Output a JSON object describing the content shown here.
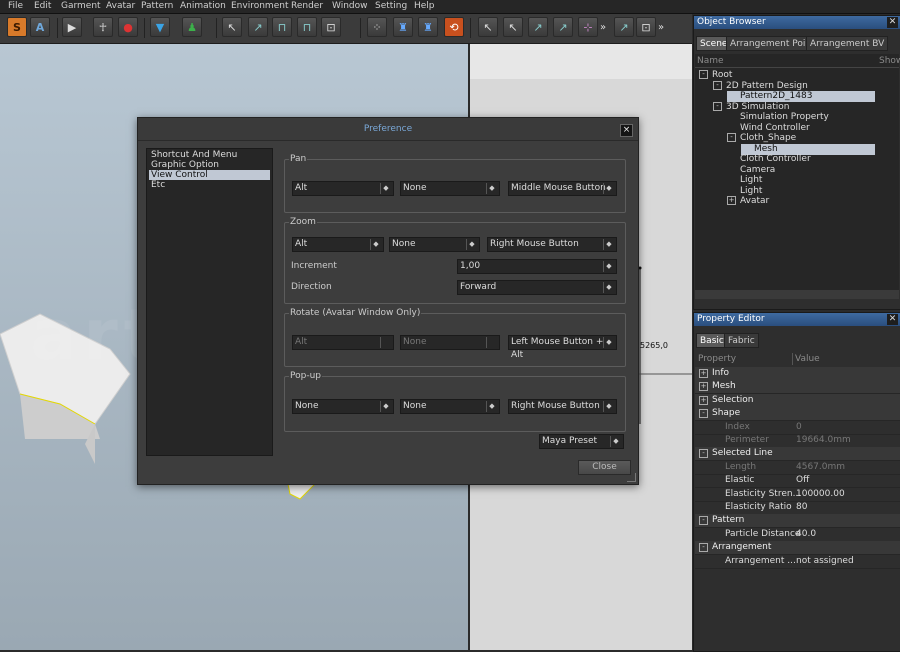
{
  "menu": [
    "File",
    "Edit",
    "Garment",
    "Avatar",
    "Pattern",
    "Animation",
    "Environment",
    "Render",
    "Window",
    "Setting",
    "Help"
  ],
  "toolbar": {
    "mode_s": "S",
    "mode_a": "A",
    "more1": "»",
    "more2": "»"
  },
  "viewport2d": {
    "measure": "5265,0"
  },
  "object_browser": {
    "title": "Object Browser",
    "tabs": [
      "Scene",
      "Arrangement Point",
      "Arrangement BV"
    ],
    "col_name": "Name",
    "col_show": "Show",
    "tree": [
      {
        "label": "Root",
        "level": 0,
        "exp": "-"
      },
      {
        "label": "2D Pattern Design",
        "level": 1,
        "exp": "-"
      },
      {
        "label": "Pattern2D_1483",
        "level": 2,
        "exp": "",
        "selected": true
      },
      {
        "label": "3D Simulation",
        "level": 1,
        "exp": "-"
      },
      {
        "label": "Simulation Property",
        "level": 2,
        "exp": ""
      },
      {
        "label": "Wind Controller",
        "level": 2,
        "exp": ""
      },
      {
        "label": "Cloth_Shape",
        "level": 2,
        "exp": "-"
      },
      {
        "label": "Mesh",
        "level": 3,
        "exp": "",
        "selected": true
      },
      {
        "label": "Cloth Controller",
        "level": 2,
        "exp": ""
      },
      {
        "label": "Camera",
        "level": 2,
        "exp": ""
      },
      {
        "label": "Light",
        "level": 2,
        "exp": ""
      },
      {
        "label": "Light",
        "level": 2,
        "exp": ""
      },
      {
        "label": "Avatar",
        "level": 2,
        "exp": "+"
      }
    ]
  },
  "property_editor": {
    "title": "Property Editor",
    "tabs": [
      "Basic",
      "Fabric"
    ],
    "col_property": "Property",
    "col_value": "Value",
    "rows": [
      {
        "type": "section",
        "exp": "+",
        "name": "Info"
      },
      {
        "type": "section",
        "exp": "+",
        "name": "Mesh"
      },
      {
        "type": "section",
        "exp": "+",
        "name": "Selection"
      },
      {
        "type": "section",
        "exp": "-",
        "name": "Shape"
      },
      {
        "type": "row",
        "name": "Index",
        "value": "0",
        "dim": true
      },
      {
        "type": "row",
        "name": "Perimeter",
        "value": "19664.0mm",
        "dim": true
      },
      {
        "type": "section",
        "exp": "-",
        "name": "Selected Line"
      },
      {
        "type": "row",
        "name": "Length",
        "value": "4567.0mm",
        "dim": true
      },
      {
        "type": "row",
        "name": "Elastic",
        "value": "Off",
        "dim": false
      },
      {
        "type": "row",
        "name": "Elasticity Stren...",
        "value": "100000.00",
        "dim": false
      },
      {
        "type": "row",
        "name": "Elasticity Ratio",
        "value": "80",
        "dim": false
      },
      {
        "type": "section",
        "exp": "-",
        "name": "Pattern"
      },
      {
        "type": "row",
        "name": "Particle Distance",
        "value": "40.0",
        "dim": false
      },
      {
        "type": "section",
        "exp": "-",
        "name": "Arrangement"
      },
      {
        "type": "row",
        "name": "Arrangement ...",
        "value": "not assigned",
        "dim": false
      }
    ]
  },
  "preference": {
    "title": "Preference",
    "close_x": "×",
    "categories": [
      "Shortcut And Menu",
      "Graphic Option",
      "View Control",
      "Etc"
    ],
    "selected_category": "View Control",
    "pan": {
      "label": "Pan",
      "key": "Alt",
      "modifier": "None",
      "button": "Middle Mouse Button"
    },
    "zoom": {
      "label": "Zoom",
      "key": "Alt",
      "modifier": "None",
      "button": "Right Mouse Button",
      "increment_label": "Increment",
      "increment_value": "1,00",
      "direction_label": "Direction",
      "direction_value": "Forward"
    },
    "rotate": {
      "label": "Rotate (Avatar Window Only)",
      "key": "Alt",
      "modifier": "None",
      "button": "Left Mouse Button + Alt"
    },
    "popup": {
      "label": "Pop-up",
      "key": "None",
      "modifier": "None",
      "button": "Right Mouse Button"
    },
    "preset": "Maya Preset",
    "close_button": "Close"
  },
  "colors": {
    "accent": "#3e6aa0",
    "dialog_title": "#7aa8d8",
    "selection": "#c0c8d4"
  }
}
